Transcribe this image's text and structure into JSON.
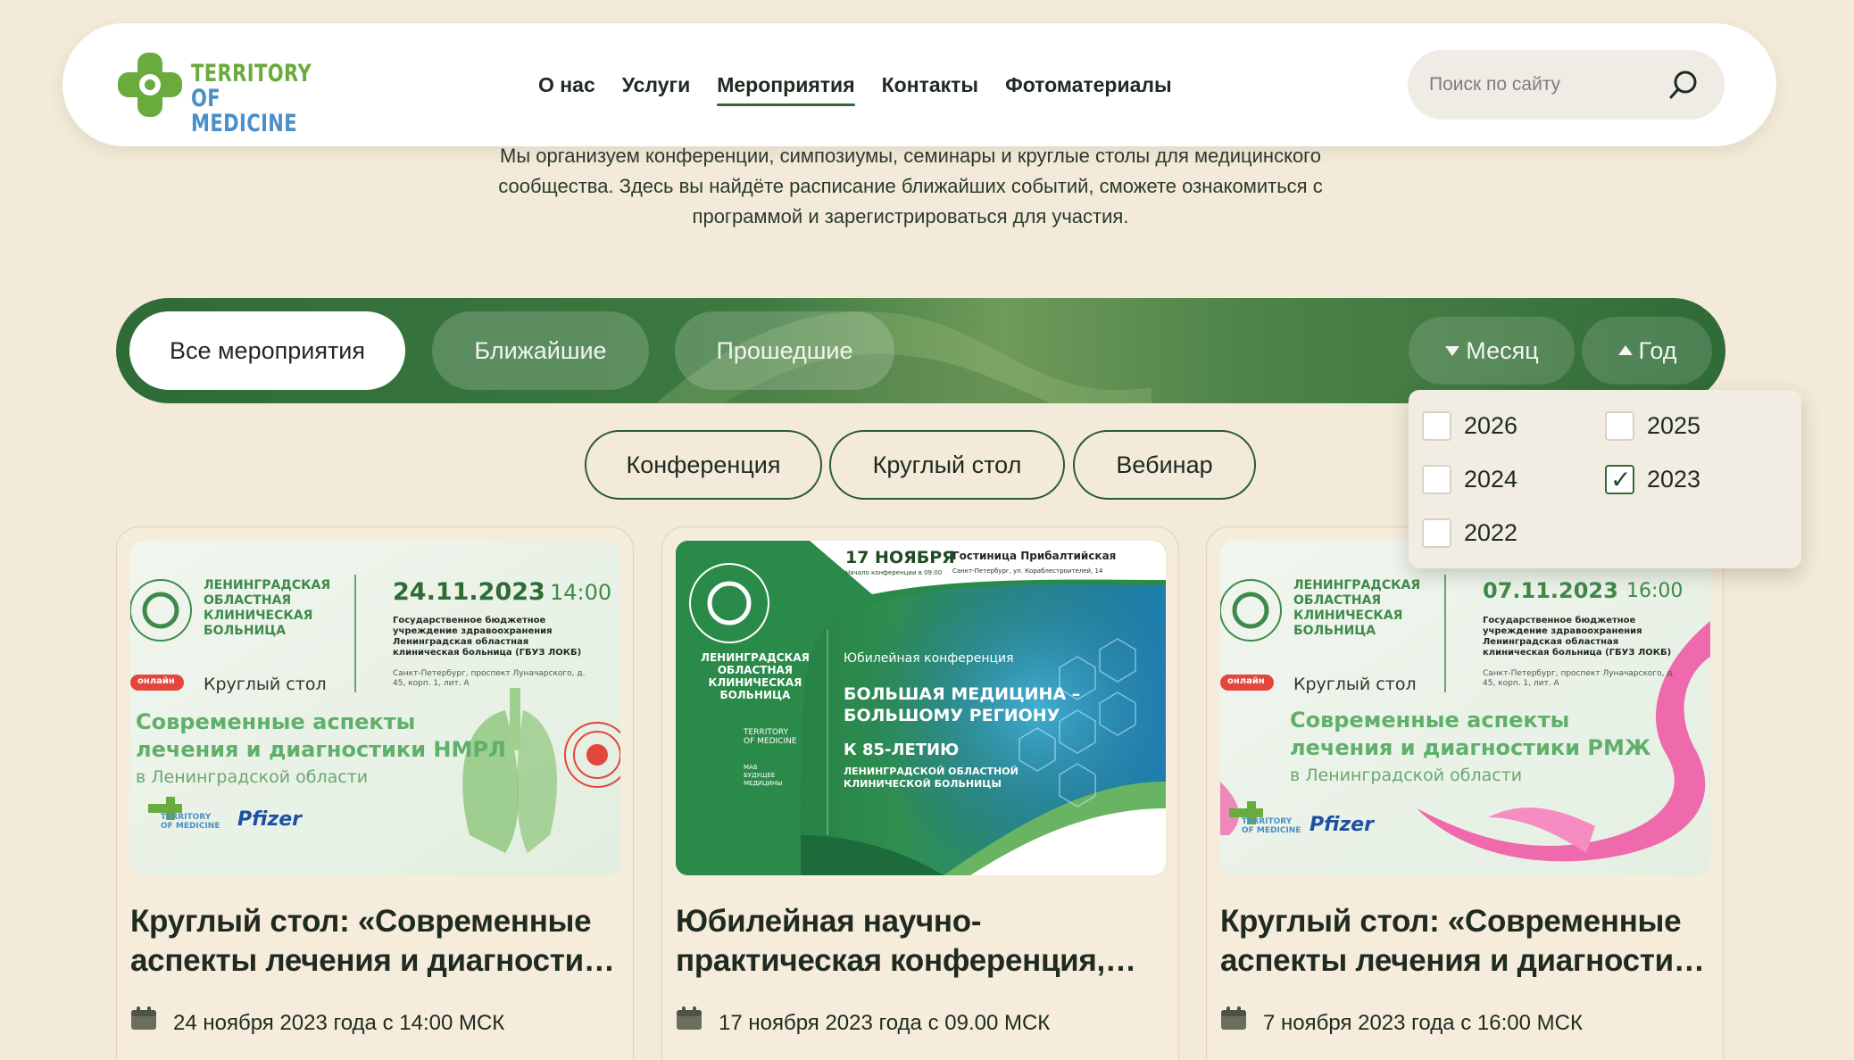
{
  "header": {
    "logo_line1": "TERRITORY",
    "logo_line2": "OF MEDICINE",
    "nav": [
      "О нас",
      "Услуги",
      "Мероприятия",
      "Контакты",
      "Фотоматериалы"
    ],
    "nav_active": "Мероприятия",
    "search_placeholder": "Поиск по сайту",
    "icons": {
      "search": "search-icon"
    }
  },
  "intro": "Мы организуем конференции, симпозиумы, семинары и круглые столы для медицинского сообщества. Здесь вы найдёте расписание ближайших событий, сможете ознакомиться с программой и зарегистрироваться для участия.",
  "filters": {
    "tabs": [
      "Все мероприятия",
      "Ближайшие",
      "Прошедшие"
    ],
    "active_tab": "Все мероприятия",
    "month_label": "Месяц",
    "year_label": "Год",
    "categories": [
      "Конференция",
      "Круглый стол",
      "Вебинар"
    ]
  },
  "year_dropdown": {
    "options": [
      {
        "label": "2026",
        "checked": false
      },
      {
        "label": "2025",
        "checked": false
      },
      {
        "label": "2024",
        "checked": false
      },
      {
        "label": "2023",
        "checked": true
      },
      {
        "label": "2022",
        "checked": false
      }
    ]
  },
  "cards": [
    {
      "title": "Круглый стол: «Современные аспекты лечения и диагностики НМРЛ в Ленинградской области»",
      "date": "24 ноября 2023 года с 14:00 МСК",
      "poster": {
        "org": "ЛЕНИНГРАДСКАЯ\nОБЛАСТНАЯ\nКЛИНИЧЕСКАЯ\nБОЛЬНИЦА",
        "date": "24.11.2023",
        "time": "14:00",
        "venue": "Государственное бюджетное учреждение здравоохранения Ленинградская областная клиническая больница (ГБУЗ ЛОКБ)",
        "address": "Санкт-Петербург, проспект Луначарского, д. 45, корп. 1, лит. А",
        "badge": "онлайн",
        "type": "Круглый стол",
        "headline": "Современные аспекты\nлечения и диагностики НМРЛ",
        "region": "в Ленинградской области",
        "sponsor": "Pfizer",
        "partner": "TERRITORY\nOF MEDICINE"
      }
    },
    {
      "title": "Юбилейная научно-практическая конференция, «Большая медицина – большому региону»",
      "date": "17 ноября 2023 года с 09.00 МСК",
      "poster": {
        "top_date": "17 НОЯБРЯ",
        "top_start": "Начало конференции в 09:00",
        "top_venue": "Гостиница Прибалтийская",
        "top_address": "Санкт-Петербург, ул. Кораблестроителей, 14",
        "org": "ЛЕНИНГРАДСКАЯ\nОБЛАСТНАЯ\nКЛИНИЧЕСКАЯ\nБОЛЬНИЦА",
        "partner": "TERRITORY\nOF MEDICINE",
        "partner2": "МАБ\nБУДУЩЕЕ\nМЕДИЦИНЫ",
        "kicker": "Юбилейная конференция",
        "headline": "БОЛЬШАЯ МЕДИЦИНА –\nБОЛЬШОМУ РЕГИОНУ",
        "sub1": "К 85-ЛЕТИЮ",
        "sub2": "ЛЕНИНГРАДСКОЙ ОБЛАСТНОЙ\nКЛИНИЧЕСКОЙ БОЛЬНИЦЫ"
      }
    },
    {
      "title": "Круглый стол: «Современные аспекты лечения и диагностики РМЖ в Ленинградской области»",
      "date": "7 ноября 2023 года с 16:00 МСК",
      "poster": {
        "org": "ЛЕНИНГРАДСКАЯ\nОБЛАСТНАЯ\nКЛИНИЧЕСКАЯ\nБОЛЬНИЦА",
        "date": "07.11.2023",
        "time": "16:00",
        "venue": "Государственное бюджетное учреждение здравоохранения Ленинградская областная клиническая больница (ГБУЗ ЛОКБ)",
        "address": "Санкт-Петербург, проспект Луначарского, д. 45, корп. 1, лит. А",
        "badge": "онлайн",
        "type": "Круглый стол",
        "headline": "Современные аспекты\nлечения и диагностики РМЖ",
        "region": "в Ленинградской области",
        "sponsor": "Pfizer",
        "partner": "TERRITORY\nOF MEDICINE"
      }
    }
  ],
  "colors": {
    "page_bg": "#f3ead9",
    "brand_green": "#2f6b37",
    "accent_green": "#6aab3e",
    "accent_blue": "#4a8fc9"
  }
}
